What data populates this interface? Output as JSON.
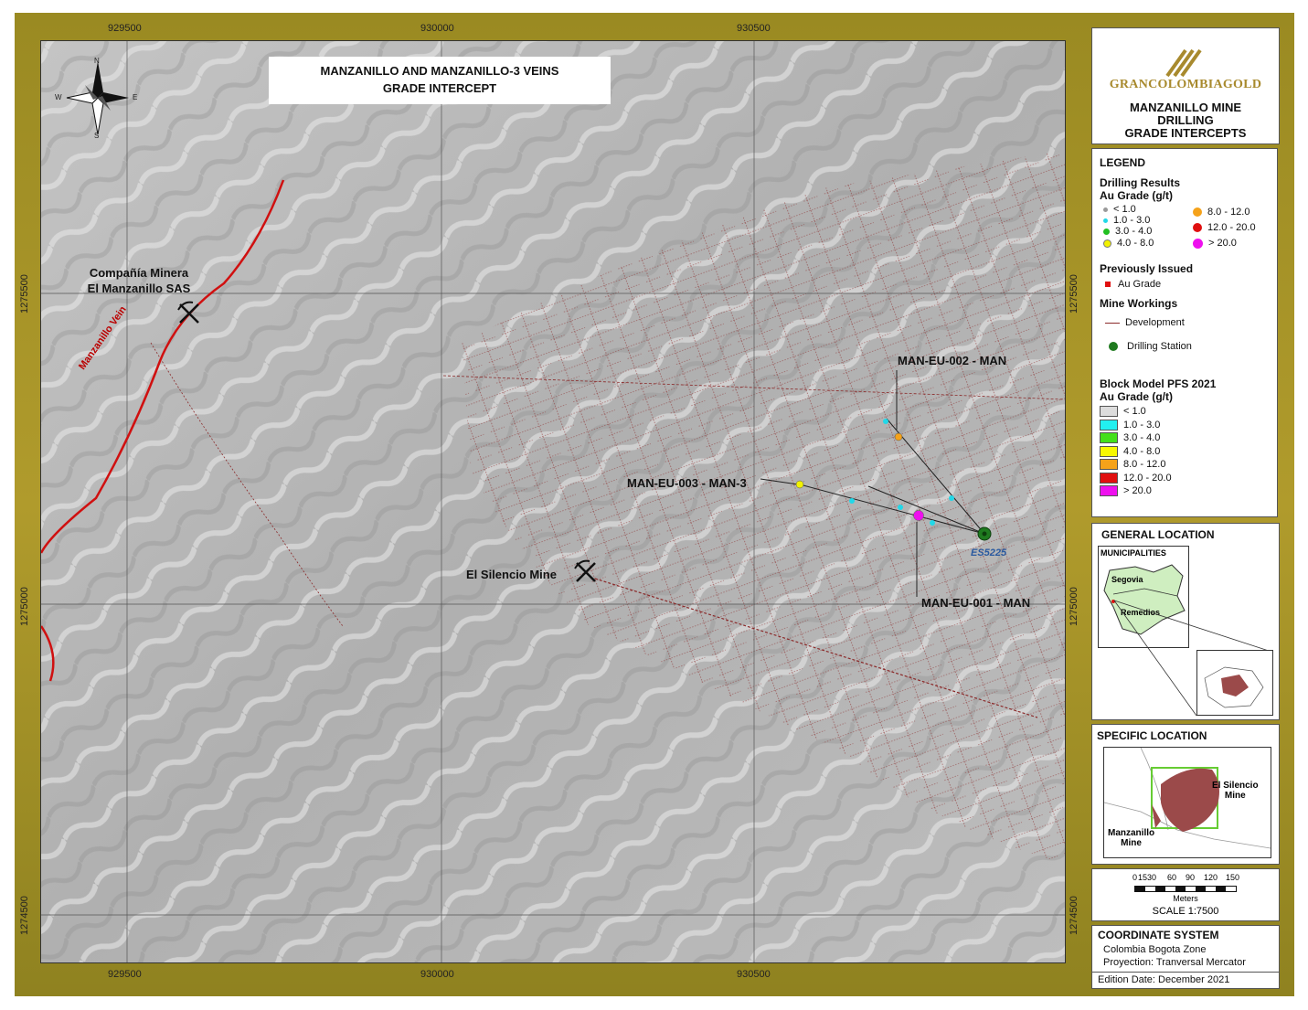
{
  "map": {
    "title_line1": "MANZANILLO AND MANZANILLO-3 VEINS",
    "title_line2": "GRADE INTERCEPT",
    "x_ticks": [
      "929500",
      "930000",
      "930500"
    ],
    "y_ticks": [
      "1275500",
      "1275000",
      "1274500"
    ],
    "north_arrow": {
      "n": "N",
      "s": "S",
      "e": "E",
      "w": "W"
    },
    "labels": {
      "company_line1": "Compañía Minera",
      "company_line2": "El Manzanillo SAS",
      "vein": "Manzanillo Vein",
      "silencio_mine": "El Silencio Mine",
      "hole_002": "MAN-EU-002 - MAN",
      "hole_003": "MAN-EU-003 - MAN-3",
      "hole_001": "MAN-EU-001 - MAN",
      "station": "ES5225"
    },
    "colors": {
      "hillshade": "#b8b8b8",
      "workings": "#8b2a2a",
      "vein": "#d01010",
      "station": "#1f7a1f"
    },
    "icons": [
      "pickaxe-icon",
      "north-arrow-icon",
      "drilling-station-icon"
    ]
  },
  "title_panel": {
    "logo_text": "GRANCOLOMBIAGOLD",
    "line1": "MANZANILLO MINE",
    "line2": "DRILLING",
    "line3": "GRADE INTERCEPTS"
  },
  "legend": {
    "title": "LEGEND",
    "drilling_title": "Drilling Results",
    "drilling_sub": "Au Grade (g/t)",
    "drilling_items": [
      {
        "label": "< 1.0",
        "color": "#9a9a9a"
      },
      {
        "label": "1.0 - 3.0",
        "color": "#22d8e8"
      },
      {
        "label": "3.0 - 4.0",
        "color": "#22c022"
      },
      {
        "label": "4.0 - 8.0",
        "color": "#f2f200"
      },
      {
        "label": "8.0 - 12.0",
        "color": "#f5a21a"
      },
      {
        "label": "12.0 - 20.0",
        "color": "#e01010"
      },
      {
        "label": "> 20.0",
        "color": "#ee10ee"
      }
    ],
    "prev_title": "Previously Issued",
    "prev_item": "Au Grade",
    "workings_title": "Mine Workings",
    "development": "Development",
    "drilling_station": "Drilling Station",
    "block_title": "Block Model PFS 2021",
    "block_sub": "Au Grade (g/t)",
    "block_items": [
      {
        "label": "< 1.0",
        "color": "#dcdcdc"
      },
      {
        "label": "1.0 - 3.0",
        "color": "#22f0f0"
      },
      {
        "label": "3.0 - 4.0",
        "color": "#44e01a"
      },
      {
        "label": "4.0 - 8.0",
        "color": "#f8f800"
      },
      {
        "label": "8.0 - 12.0",
        "color": "#f5a21a"
      },
      {
        "label": "12.0 - 20.0",
        "color": "#e01010"
      },
      {
        "label": "> 20.0",
        "color": "#ee10ee"
      }
    ]
  },
  "general_location": {
    "title": "GENERAL LOCATION",
    "box_title": "MUNICIPALITIES",
    "segovia": "Segovia",
    "remedios": "Remedios"
  },
  "specific_location": {
    "title": "SPECIFIC LOCATION",
    "silencio_line1": "El Silencio",
    "silencio_line2": "Mine",
    "manzanillo_line1": "Manzanillo",
    "manzanillo_line2": "Mine"
  },
  "scale": {
    "ticks": [
      "0",
      "15",
      "30",
      "60",
      "90",
      "120",
      "150"
    ],
    "unit": "Meters",
    "text": "SCALE 1:7500"
  },
  "coordinate_system": {
    "title": "COORDINATE SYSTEM",
    "line1": "Colombia Bogota Zone",
    "line2": "Proyection: Tranversal Mercator",
    "edition": "Edition Date: December 2021"
  }
}
